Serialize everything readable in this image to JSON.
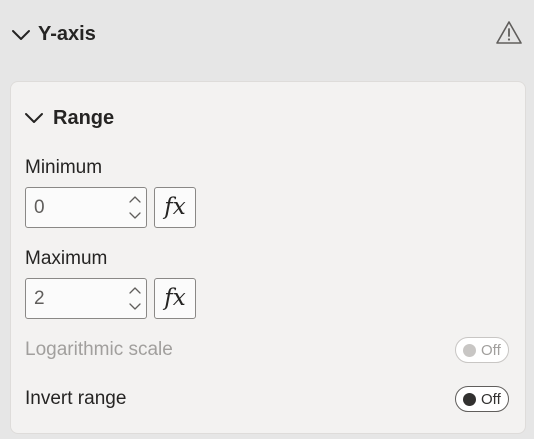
{
  "section": {
    "title": "Y-axis",
    "expanded": true,
    "warning_icon": "warning-triangle-icon"
  },
  "range_card": {
    "title": "Range",
    "expanded": true,
    "minimum": {
      "label": "Minimum",
      "value": "0",
      "fx_label": "fx"
    },
    "maximum": {
      "label": "Maximum",
      "value": "2",
      "fx_label": "fx"
    },
    "logarithmic_scale": {
      "label": "Logarithmic scale",
      "state": "Off",
      "disabled": true
    },
    "invert_range": {
      "label": "Invert range",
      "state": "Off",
      "disabled": false
    }
  },
  "colors": {
    "background": "#e6e6e6",
    "card": "#f3f2f1",
    "text": "#252423",
    "disabled_text": "#a19f9d",
    "input_border": "#8a8886"
  }
}
